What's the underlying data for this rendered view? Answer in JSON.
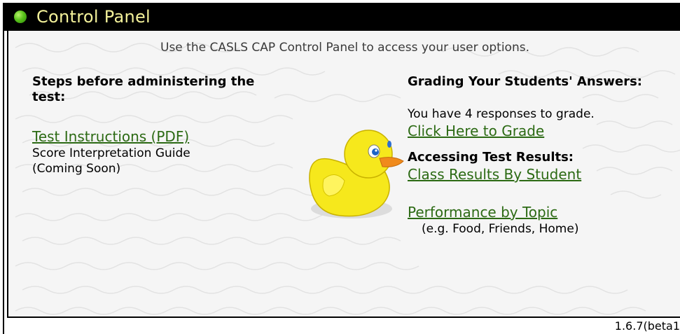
{
  "header": {
    "title": "Control Panel"
  },
  "panel": {
    "subtitle": "Use the CASLS CAP Control Panel to access your user options.",
    "left": {
      "heading": "Steps before administering the test:",
      "test_instructions_link": "Test Instructions (PDF)",
      "score_guide_line1": "Score Interpretation Guide",
      "score_guide_line2": "(Coming Soon)"
    },
    "right": {
      "grading_heading": "Grading Your Students' Answers:",
      "responses_text": "You have 4 responses to grade.",
      "grade_link": "Click Here to Grade",
      "results_heading": "Accessing Test Results:",
      "class_results_link": "Class Results By Student",
      "topic_link": "Performance by Topic",
      "topic_example": "(e.g. Food, Friends, Home)"
    }
  },
  "footer": {
    "version": "1.6.7(beta1"
  },
  "colors": {
    "header_bg": "#000000",
    "header_text": "#f3f19a",
    "status_dot": "#5ac21c",
    "link": "#2c6a14",
    "duck_body": "#f6e81c",
    "duck_beak": "#f08a1c"
  },
  "icons": [
    "status-dot-icon",
    "duck-mascot-icon"
  ]
}
